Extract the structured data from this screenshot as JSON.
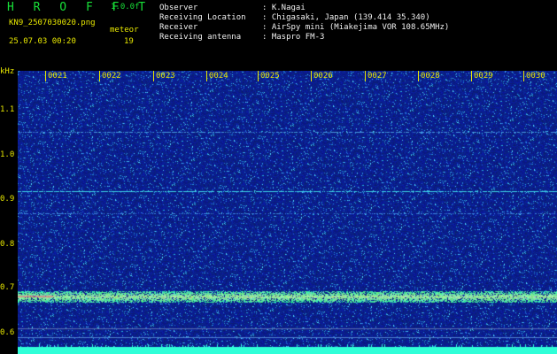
{
  "app": {
    "brand": "H R O F F T",
    "version": "1.0.0f"
  },
  "file": {
    "name": "KN9_2507030020.png",
    "mode_label": "meteor",
    "datetime": "25.07.03 00:20",
    "count": "19"
  },
  "info": [
    {
      "key": "Observer",
      "value": ": K.Nagai"
    },
    {
      "key": "Receiving Location",
      "value": ": Chigasaki, Japan (139.414 35.340)"
    },
    {
      "key": "Receiver",
      "value": ": AirSpy mini (Miakejima VOR 108.65MHz)"
    },
    {
      "key": "Receiving antenna",
      "value": ": Maspro FM-3"
    }
  ],
  "axis": {
    "y_unit": "kHz",
    "y_ticks": [
      "1.1",
      "1.0",
      "0.9",
      "0.8",
      "0.7",
      "0.6"
    ],
    "x_ticks": [
      "0021",
      "0022",
      "0023",
      "0024",
      "0025",
      "0026",
      "0027",
      "0028",
      "0029",
      "0030"
    ]
  },
  "colors": {
    "header_text": "#e8e800",
    "brand": "#18e038",
    "background": "#0a1a7a",
    "signal": "#30ffd8"
  }
}
